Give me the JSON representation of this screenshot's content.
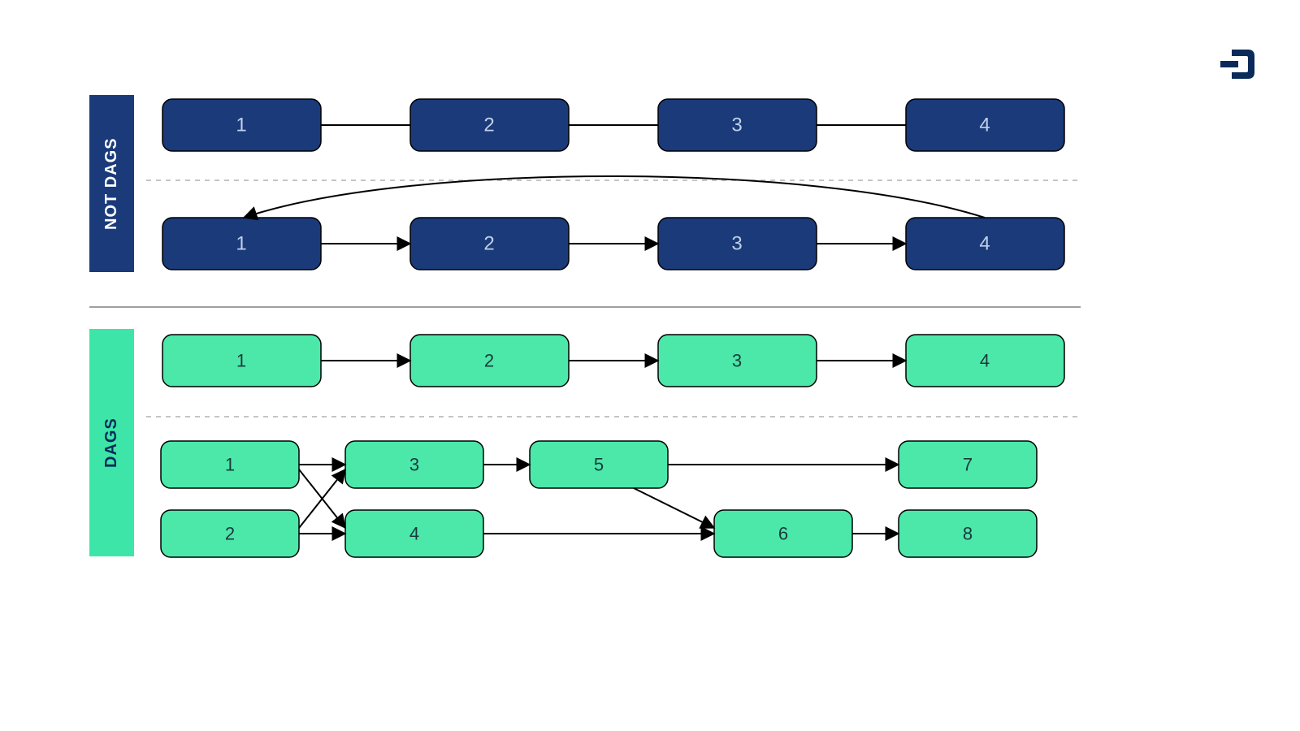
{
  "labels": {
    "not_dags": "NOT DAGS",
    "dags": "DAGS"
  },
  "colors": {
    "navy": "#1a3a7a",
    "green": "#4be8aa",
    "logo": "#0a2a5a"
  },
  "diagrams": {
    "not_dags_1": {
      "description": "linear chain, undirected edges",
      "nodes": [
        "1",
        "2",
        "3",
        "4"
      ],
      "edges": [
        [
          "1",
          "2"
        ],
        [
          "2",
          "3"
        ],
        [
          "3",
          "4"
        ]
      ],
      "directed": false
    },
    "not_dags_2": {
      "description": "linear directed chain with back-edge cycle 4→1",
      "nodes": [
        "1",
        "2",
        "3",
        "4"
      ],
      "edges": [
        [
          "1",
          "2"
        ],
        [
          "2",
          "3"
        ],
        [
          "3",
          "4"
        ],
        [
          "4",
          "1"
        ]
      ],
      "directed": true
    },
    "dags_1": {
      "description": "simple directed linear chain",
      "nodes": [
        "1",
        "2",
        "3",
        "4"
      ],
      "edges": [
        [
          "1",
          "2"
        ],
        [
          "2",
          "3"
        ],
        [
          "3",
          "4"
        ]
      ],
      "directed": true
    },
    "dags_2": {
      "description": "branching DAG",
      "nodes": [
        "1",
        "2",
        "3",
        "4",
        "5",
        "6",
        "7",
        "8"
      ],
      "edges": [
        [
          "1",
          "3"
        ],
        [
          "1",
          "4"
        ],
        [
          "2",
          "3"
        ],
        [
          "2",
          "4"
        ],
        [
          "3",
          "5"
        ],
        [
          "4",
          "6"
        ],
        [
          "5",
          "6"
        ],
        [
          "5",
          "7"
        ],
        [
          "6",
          "8"
        ]
      ],
      "directed": true
    }
  },
  "node_labels": {
    "n1": "1",
    "n2": "2",
    "n3": "3",
    "n4": "4",
    "n5": "5",
    "n6": "6",
    "n7": "7",
    "n8": "8"
  }
}
